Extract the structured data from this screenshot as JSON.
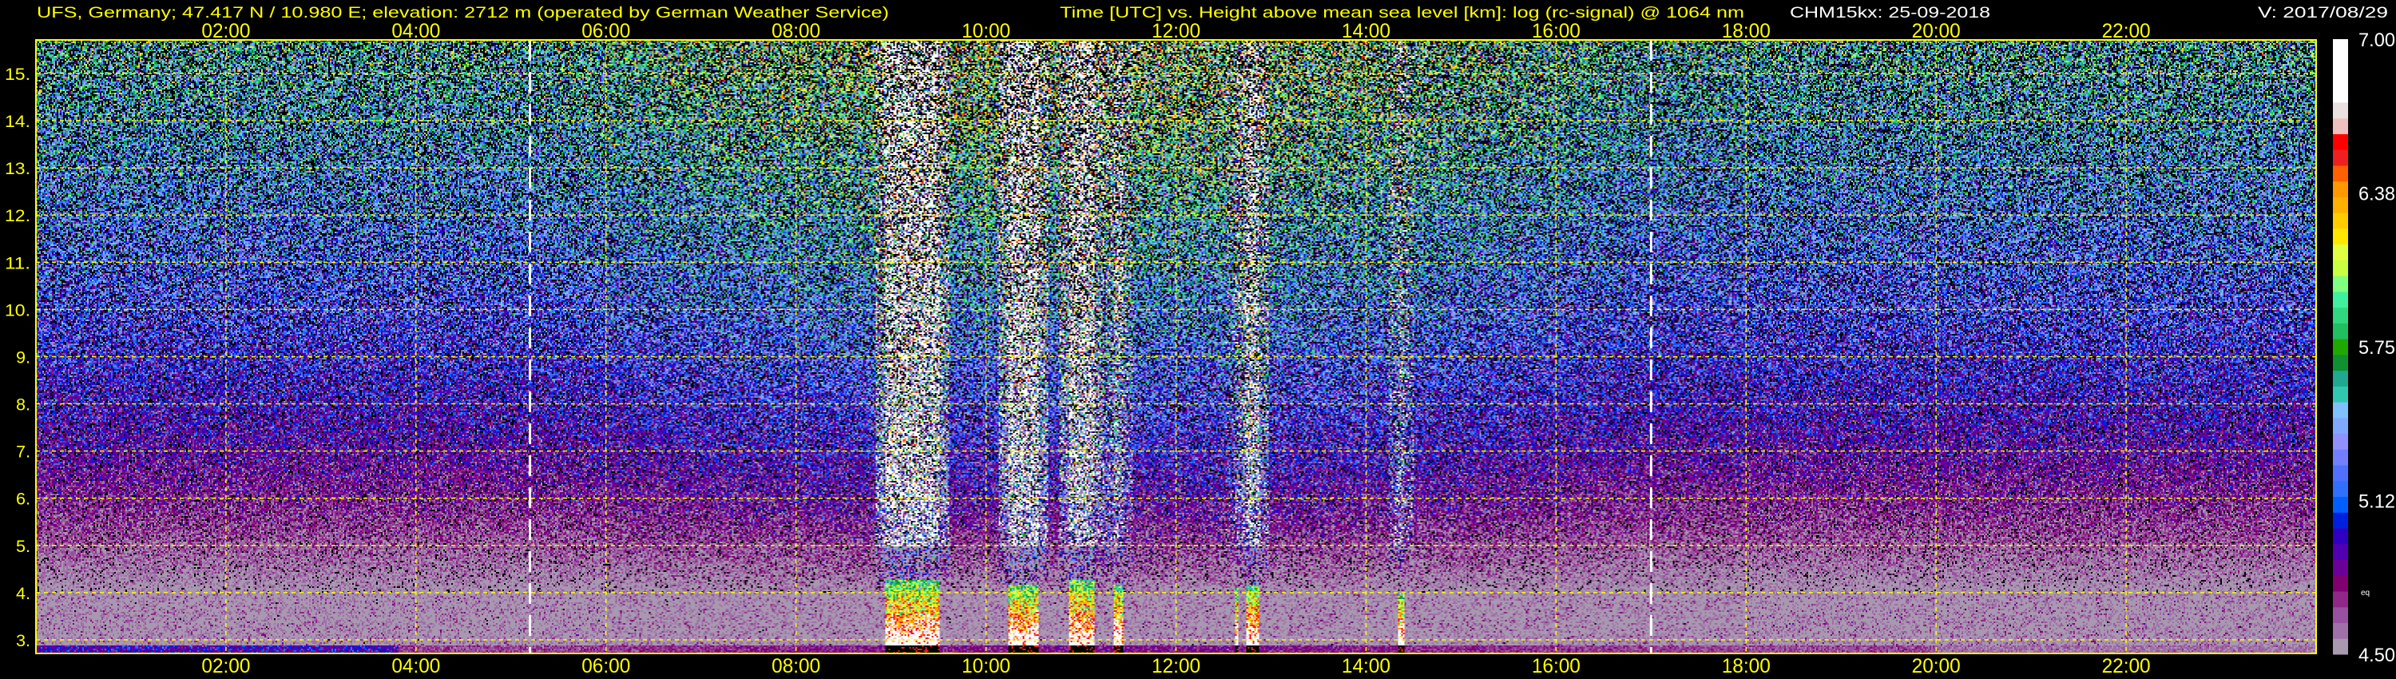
{
  "header": {
    "station": "UFS, Germany; 47.417 N / 10.980 E; elevation: 2712 m  (operated by German Weather Service)",
    "plot_title": "Time [UTC] vs. Height above mean sea level [km]: log (rc-signal) @ 1064 nm",
    "instrument_date": "CHM15kx: 25-09-2018",
    "version": "V: 2017/08/29"
  },
  "colors": {
    "axis": "#ffff00",
    "grid": "#ffff00",
    "label_white": "#ffffff",
    "background": "#000000",
    "marker": "#ffffff"
  },
  "chart_data": {
    "type": "heatmap",
    "title": "Time [UTC] vs. Height above mean sea level [km]: log (rc-signal) @ 1064 nm",
    "xlabel": "Time [UTC]",
    "ylabel": "Height above mean sea level [km]",
    "xlim_hours": [
      0,
      24
    ],
    "ylim_km": [
      2.712,
      15.71
    ],
    "x_ticks": [
      {
        "value": 2,
        "label": "02:00"
      },
      {
        "value": 4,
        "label": "04:00"
      },
      {
        "value": 6,
        "label": "06:00"
      },
      {
        "value": 8,
        "label": "08:00"
      },
      {
        "value": 10,
        "label": "10:00"
      },
      {
        "value": 12,
        "label": "12:00"
      },
      {
        "value": 14,
        "label": "14:00"
      },
      {
        "value": 16,
        "label": "16:00"
      },
      {
        "value": 18,
        "label": "18:00"
      },
      {
        "value": 20,
        "label": "20:00"
      },
      {
        "value": 22,
        "label": "22:00"
      }
    ],
    "y_ticks": [
      {
        "value": 3,
        "label": "3."
      },
      {
        "value": 4,
        "label": "4."
      },
      {
        "value": 5,
        "label": "5."
      },
      {
        "value": 6,
        "label": "6."
      },
      {
        "value": 7,
        "label": "7."
      },
      {
        "value": 8,
        "label": "8."
      },
      {
        "value": 9,
        "label": "9."
      },
      {
        "value": 10,
        "label": "10."
      },
      {
        "value": 11,
        "label": "11."
      },
      {
        "value": 12,
        "label": "12."
      },
      {
        "value": 13,
        "label": "13."
      },
      {
        "value": 14,
        "label": "14."
      },
      {
        "value": 15,
        "label": "15."
      }
    ],
    "grid": true,
    "sun_markers_hours": [
      5.2,
      17.0
    ],
    "colorbar": {
      "range": [
        4.5,
        7.0
      ],
      "ticks": [
        {
          "value": 7.0,
          "label": "7.00"
        },
        {
          "value": 6.375,
          "label": "6.38"
        },
        {
          "value": 5.75,
          "label": "5.75"
        },
        {
          "value": 5.125,
          "label": "5.12"
        },
        {
          "value": 4.5,
          "label": "4.50"
        }
      ],
      "note": "eq",
      "colors": [
        "#a898b0",
        "#a070a8",
        "#9850a0",
        "#902888",
        "#800070",
        "#6a0098",
        "#5000b0",
        "#3000c0",
        "#0020e0",
        "#0060ff",
        "#3070ff",
        "#5070ff",
        "#7080ff",
        "#9090ff",
        "#80a8ff",
        "#80c0ff",
        "#30c8b0",
        "#20a890",
        "#109030",
        "#20a800",
        "#20c060",
        "#30d880",
        "#40f0a0",
        "#80ff80",
        "#c8ff40",
        "#e0ff40",
        "#ffe800",
        "#ffcc00",
        "#ffb000",
        "#ff9900",
        "#ff6000",
        "#f02020",
        "#ff0000",
        "#f0c0c0",
        "#ebe0e0",
        "#ffffff",
        "#ffffff",
        "#ffffff",
        "#ffffff"
      ]
    },
    "cloud_events": [
      {
        "start": 8.94,
        "end": 9.5,
        "top_km": 4.3,
        "plume": 1.0
      },
      {
        "start": 10.23,
        "end": 10.55,
        "top_km": 4.2,
        "plume": 1.0
      },
      {
        "start": 10.87,
        "end": 11.13,
        "top_km": 4.3,
        "plume": 0.9
      },
      {
        "start": 11.33,
        "end": 11.44,
        "top_km": 4.2,
        "plume": 0.5
      },
      {
        "start": 12.61,
        "end": 12.65,
        "top_km": 4.1,
        "plume": 0.2
      },
      {
        "start": 12.73,
        "end": 12.86,
        "top_km": 4.2,
        "plume": 0.8
      },
      {
        "start": 14.32,
        "end": 14.4,
        "top_km": 4.0,
        "plume": 0.4
      }
    ]
  }
}
